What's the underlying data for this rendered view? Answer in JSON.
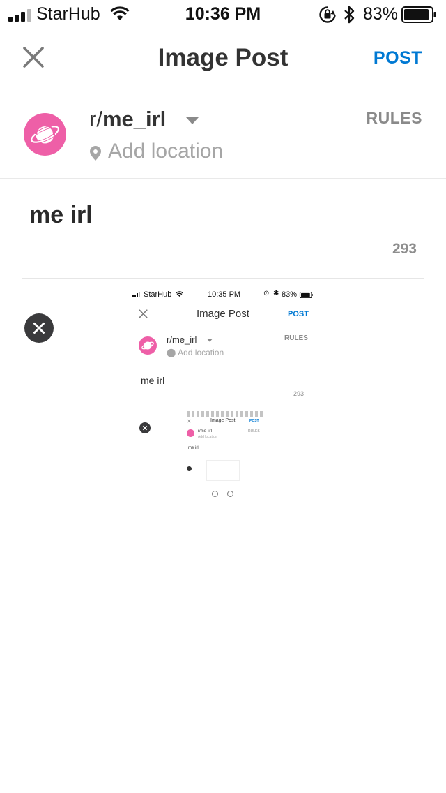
{
  "status_bar": {
    "carrier": "StarHub",
    "time": "10:36 PM",
    "battery_percent": "83%",
    "icons": [
      "signal-icon",
      "wifi-icon",
      "orientation-lock-icon",
      "bluetooth-icon",
      "battery-icon"
    ]
  },
  "nav": {
    "title": "Image Post",
    "post_label": "POST",
    "close_icon": "close-icon"
  },
  "community": {
    "prefix": "r/",
    "name": "me_irl",
    "location_placeholder": "Add location",
    "rules_label": "RULES"
  },
  "post": {
    "title": "me irl",
    "chars_remaining": "293"
  },
  "image_thumbnail": {
    "status_carrier": "StarHub",
    "status_time": "10:35 PM",
    "status_battery": "83%",
    "title": "Image Post",
    "post_label": "POST",
    "community": "r/me_irl",
    "location": "Add location",
    "rules_label": "RULES",
    "post_title": "me irl",
    "chars_remaining": "293",
    "nested": {
      "title": "Image Post",
      "post_label": "POST",
      "community": "r/me_irl",
      "location": "Add location",
      "rules_label": "RULES",
      "post_title": "me irl"
    }
  },
  "colors": {
    "accent_blue": "#0079d3",
    "avatar_pink": "#ee5fa7",
    "text_dark": "#333333",
    "text_muted": "#a6a6a6"
  }
}
